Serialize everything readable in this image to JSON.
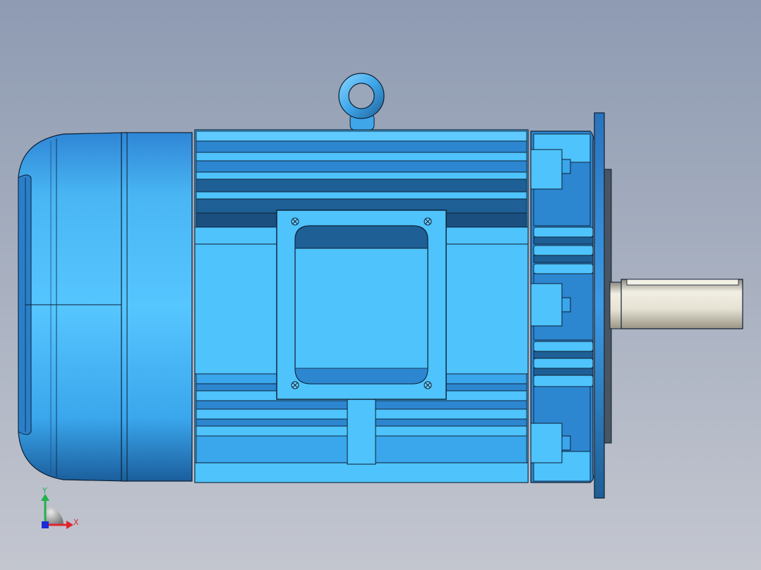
{
  "viewport": {
    "background_top": "#8e9bb2",
    "background_bottom": "#c3c6cf"
  },
  "model": {
    "body_color": "#4fc3fb",
    "body_dark": "#1e5f95",
    "body_mid": "#2d86d0",
    "shaft_color": "#e6e2d3",
    "outline_color": "#0d1f33"
  },
  "triad": {
    "x_label": "X",
    "y_label": "Y",
    "x_color": "#e0242c",
    "y_color": "#22b14c",
    "origin_color": "#1b2bd6"
  }
}
